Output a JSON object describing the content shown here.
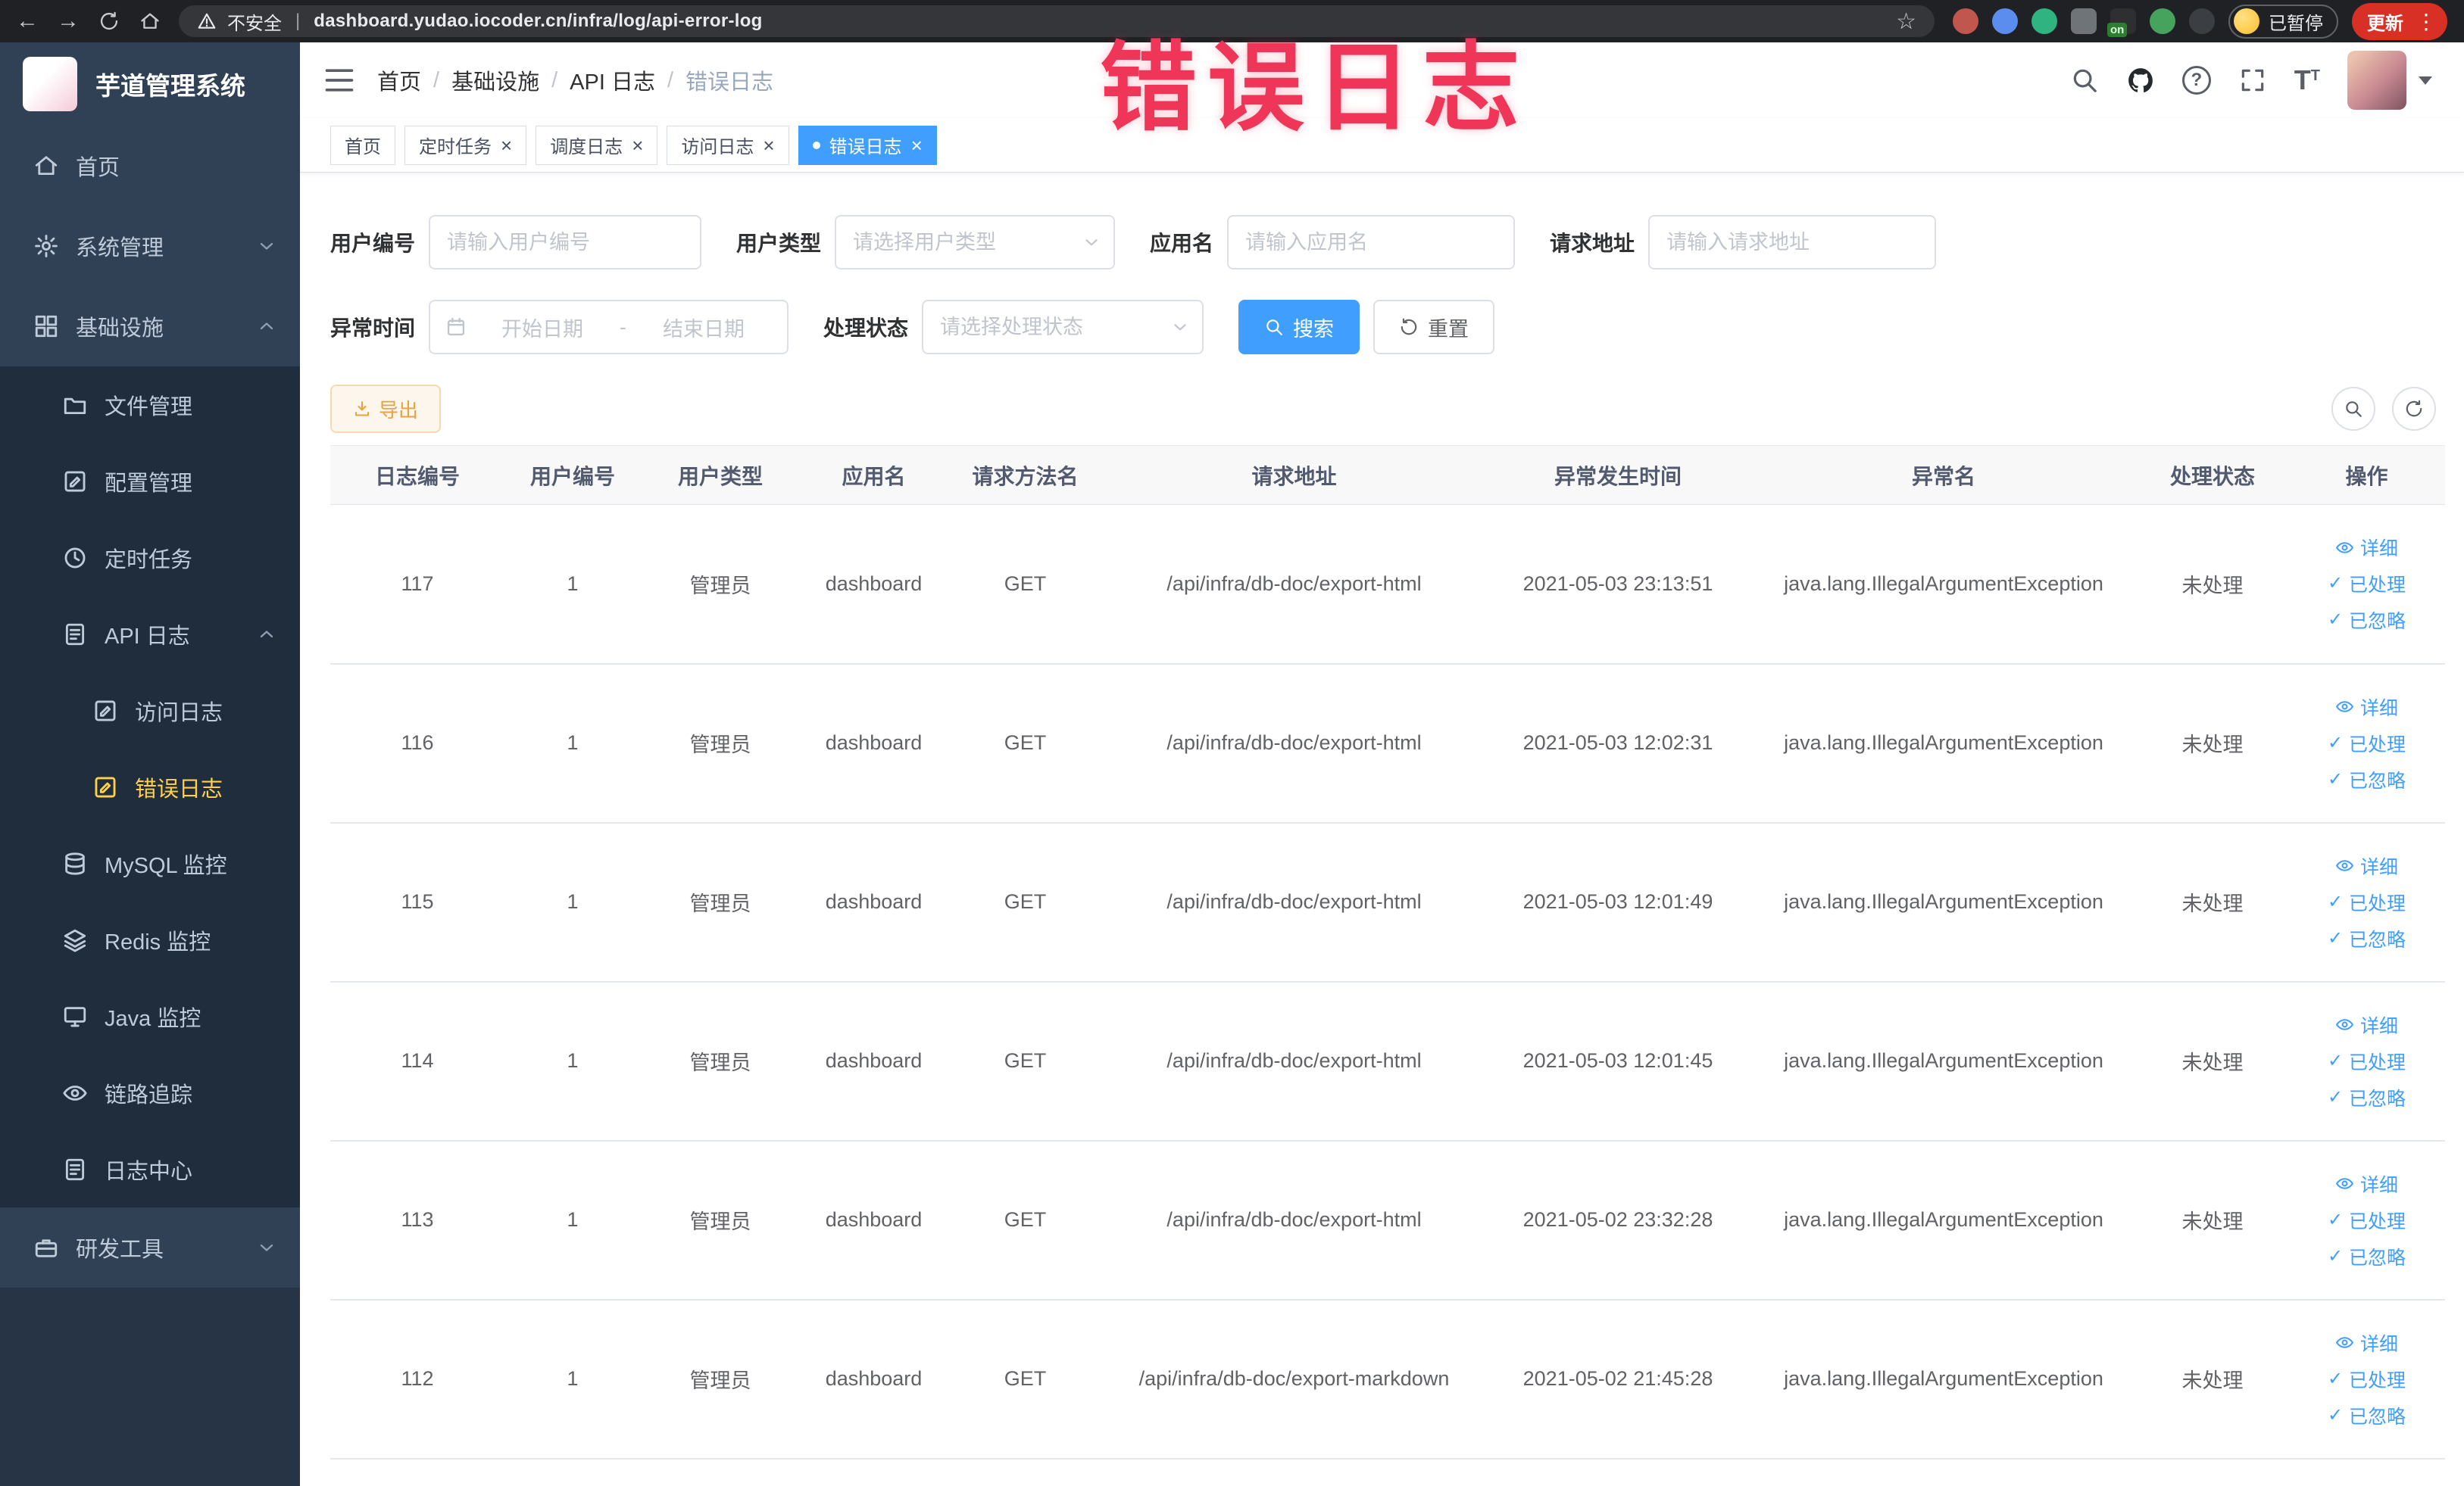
{
  "browser": {
    "security_label": "不安全",
    "url": "dashboard.yudao.iocoder.cn/infra/log/api-error-log",
    "ext_badge": "on",
    "paused_label": "已暂停",
    "update_label": "更新"
  },
  "annotation": {
    "text": "错误日志"
  },
  "sidebar": {
    "logo_title": "芋道管理系统",
    "menu": {
      "home": "首页",
      "system": "系统管理",
      "infra": "基础设施",
      "file": "文件管理",
      "config": "配置管理",
      "job": "定时任务",
      "api_log": "API 日志",
      "access_log": "访问日志",
      "error_log": "错误日志",
      "mysql": "MySQL 监控",
      "redis": "Redis 监控",
      "java": "Java 监控",
      "trace": "链路追踪",
      "log_center": "日志中心",
      "dev_tools": "研发工具"
    }
  },
  "header": {
    "breadcrumb": [
      "首页",
      "基础设施",
      "API 日志",
      "错误日志"
    ],
    "breadcrumb_separator": "/"
  },
  "tabs": [
    {
      "label": "首页",
      "closable": false,
      "active": false
    },
    {
      "label": "定时任务",
      "closable": true,
      "active": false
    },
    {
      "label": "调度日志",
      "closable": true,
      "active": false
    },
    {
      "label": "访问日志",
      "closable": true,
      "active": false
    },
    {
      "label": "错误日志",
      "closable": true,
      "active": true
    }
  ],
  "filters": {
    "user_id_label": "用户编号",
    "user_id_placeholder": "请输入用户编号",
    "user_type_label": "用户类型",
    "user_type_placeholder": "请选择用户类型",
    "app_name_label": "应用名",
    "app_name_placeholder": "请输入应用名",
    "request_url_label": "请求地址",
    "request_url_placeholder": "请输入请求地址",
    "exception_time_label": "异常时间",
    "date_start_placeholder": "开始日期",
    "date_separator": "-",
    "date_end_placeholder": "结束日期",
    "process_status_label": "处理状态",
    "process_status_placeholder": "请选择处理状态",
    "search_button": "搜索",
    "reset_button": "重置"
  },
  "toolbar": {
    "export_button": "导出"
  },
  "table": {
    "columns": [
      "日志编号",
      "用户编号",
      "用户类型",
      "应用名",
      "请求方法名",
      "请求地址",
      "异常发生时间",
      "异常名",
      "处理状态",
      "操作"
    ],
    "ops": {
      "detail": "详细",
      "processed": "已处理",
      "ignored": "已忽略"
    },
    "rows": [
      {
        "id": "117",
        "user_id": "1",
        "user_type": "管理员",
        "app": "dashboard",
        "method": "GET",
        "url": "/api/infra/db-doc/export-html",
        "time": "2021-05-03 23:13:51",
        "exception": "java.lang.IllegalArgumentException",
        "status": "未处理"
      },
      {
        "id": "116",
        "user_id": "1",
        "user_type": "管理员",
        "app": "dashboard",
        "method": "GET",
        "url": "/api/infra/db-doc/export-html",
        "time": "2021-05-03 12:02:31",
        "exception": "java.lang.IllegalArgumentException",
        "status": "未处理"
      },
      {
        "id": "115",
        "user_id": "1",
        "user_type": "管理员",
        "app": "dashboard",
        "method": "GET",
        "url": "/api/infra/db-doc/export-html",
        "time": "2021-05-03 12:01:49",
        "exception": "java.lang.IllegalArgumentException",
        "status": "未处理"
      },
      {
        "id": "114",
        "user_id": "1",
        "user_type": "管理员",
        "app": "dashboard",
        "method": "GET",
        "url": "/api/infra/db-doc/export-html",
        "time": "2021-05-03 12:01:45",
        "exception": "java.lang.IllegalArgumentException",
        "status": "未处理"
      },
      {
        "id": "113",
        "user_id": "1",
        "user_type": "管理员",
        "app": "dashboard",
        "method": "GET",
        "url": "/api/infra/db-doc/export-html",
        "time": "2021-05-02 23:32:28",
        "exception": "java.lang.IllegalArgumentException",
        "status": "未处理"
      },
      {
        "id": "112",
        "user_id": "1",
        "user_type": "管理员",
        "app": "dashboard",
        "method": "GET",
        "url": "/api/infra/db-doc/export-markdown",
        "time": "2021-05-02 21:45:28",
        "exception": "java.lang.IllegalArgumentException",
        "status": "未处理"
      }
    ]
  },
  "colors": {
    "primary": "#409EFF",
    "warning": "#E6A23C",
    "sidebar_bg": "#304156",
    "submenu_bg": "#1F2D3D",
    "sidebar_active_text": "#FFD04B",
    "active_tab_bg": "#409EFF",
    "annotation_red": "#EF3558",
    "update_button_bg": "#D93025"
  }
}
